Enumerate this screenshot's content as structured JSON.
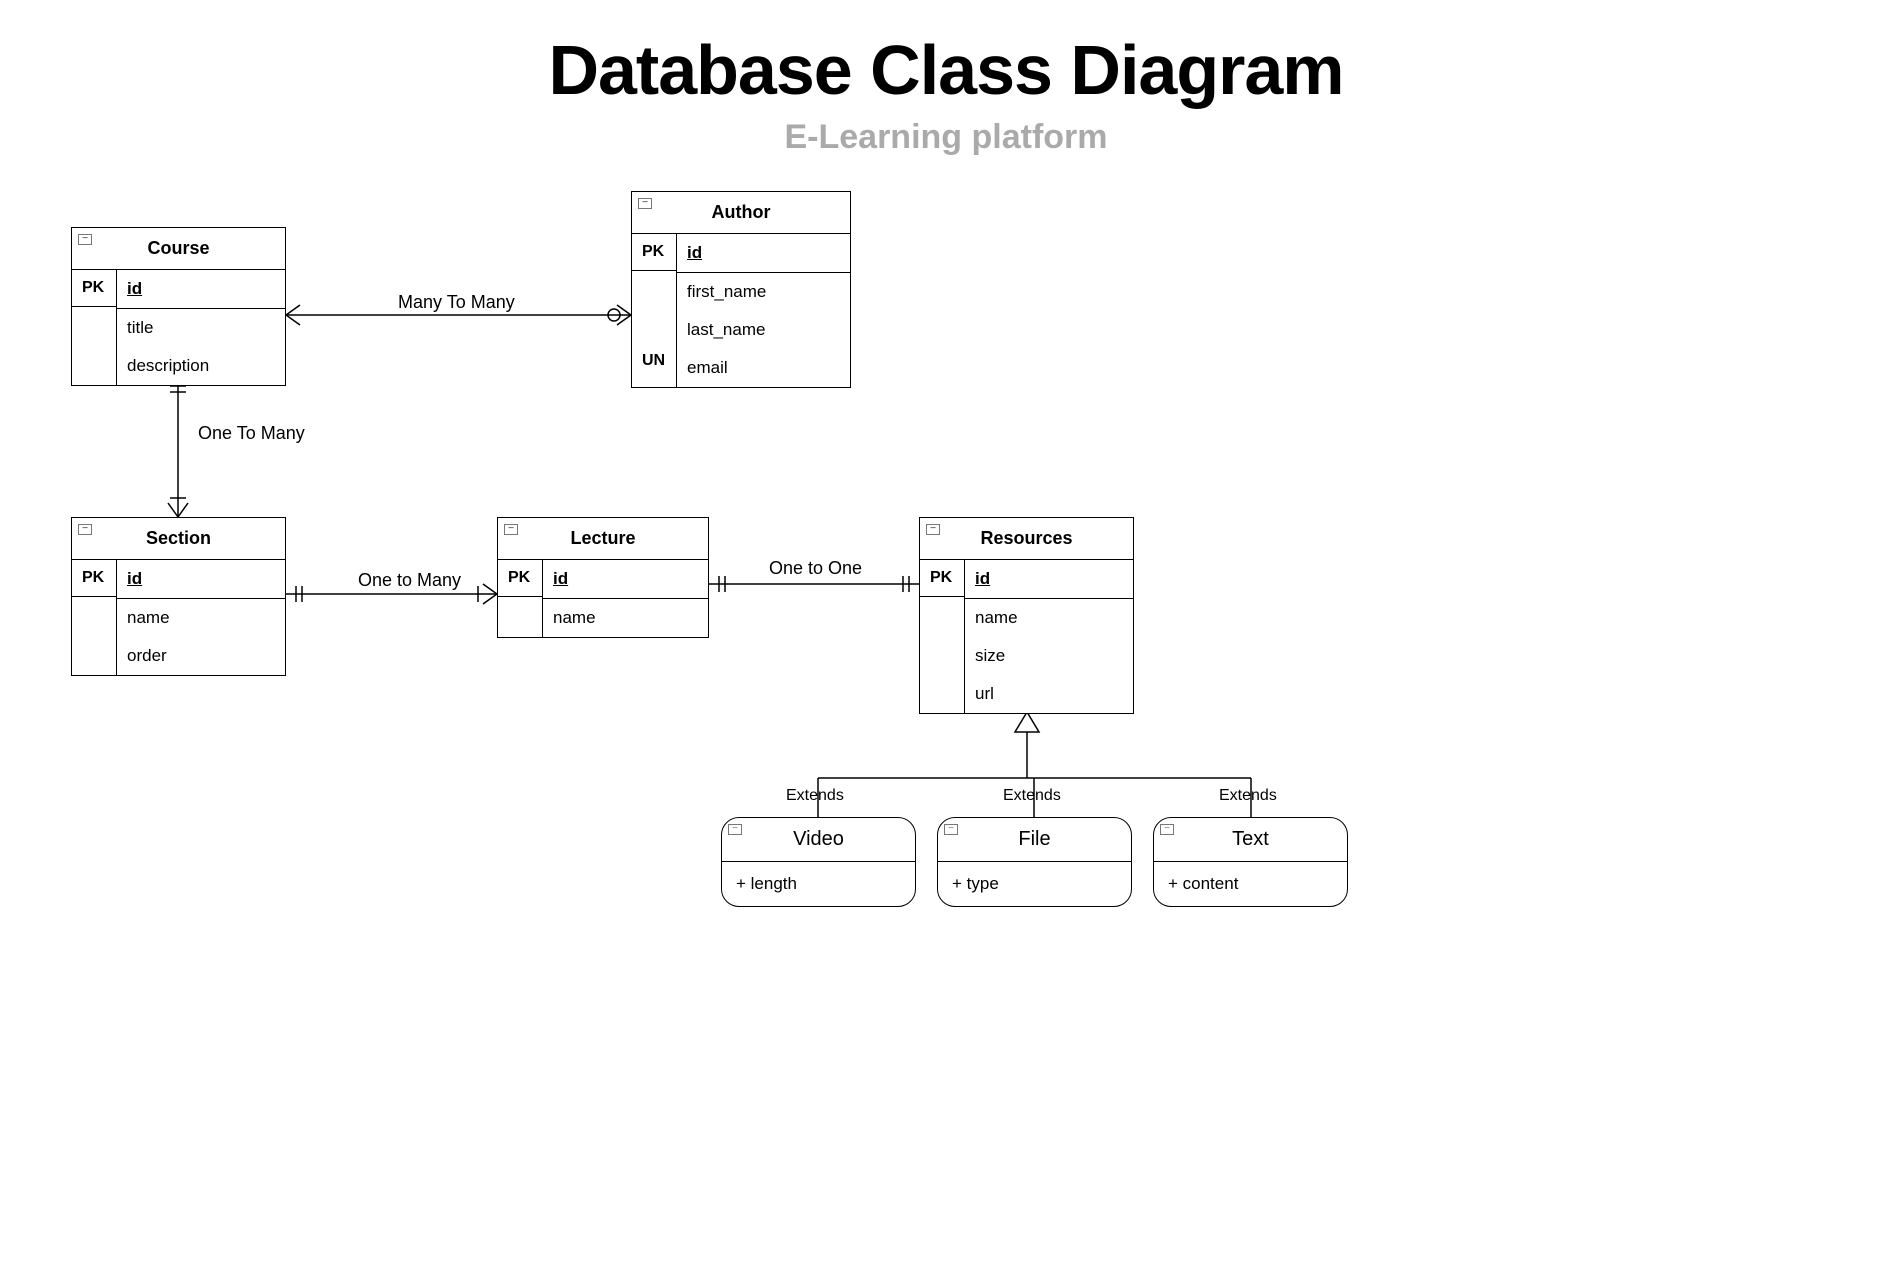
{
  "header": {
    "title": "Database Class Diagram",
    "subtitle": "E-Learning platform"
  },
  "entities": {
    "course": {
      "name": "Course",
      "pk_label": "PK",
      "pk_field": "id",
      "fields": [
        "title",
        "description"
      ]
    },
    "author": {
      "name": "Author",
      "pk_label": "PK",
      "pk_field": "id",
      "fields": [
        "first_name",
        "last_name",
        "email"
      ],
      "un_label": "UN"
    },
    "section": {
      "name": "Section",
      "pk_label": "PK",
      "pk_field": "id",
      "fields": [
        "name",
        "order"
      ]
    },
    "lecture": {
      "name": "Lecture",
      "pk_label": "PK",
      "pk_field": "id",
      "fields": [
        "name"
      ]
    },
    "resources": {
      "name": "Resources",
      "pk_label": "PK",
      "pk_field": "id",
      "fields": [
        "name",
        "size",
        "url"
      ]
    }
  },
  "children": {
    "video": {
      "name": "Video",
      "attr": "+ length"
    },
    "file": {
      "name": "File",
      "attr": "+ type"
    },
    "text": {
      "name": "Text",
      "attr": "+ content"
    }
  },
  "labels": {
    "course_author": "Many To Many",
    "course_section": "One To Many",
    "section_lecture": "One to Many",
    "lecture_resources": "One to One",
    "extends1": "Extends",
    "extends2": "Extends",
    "extends3": "Extends"
  }
}
